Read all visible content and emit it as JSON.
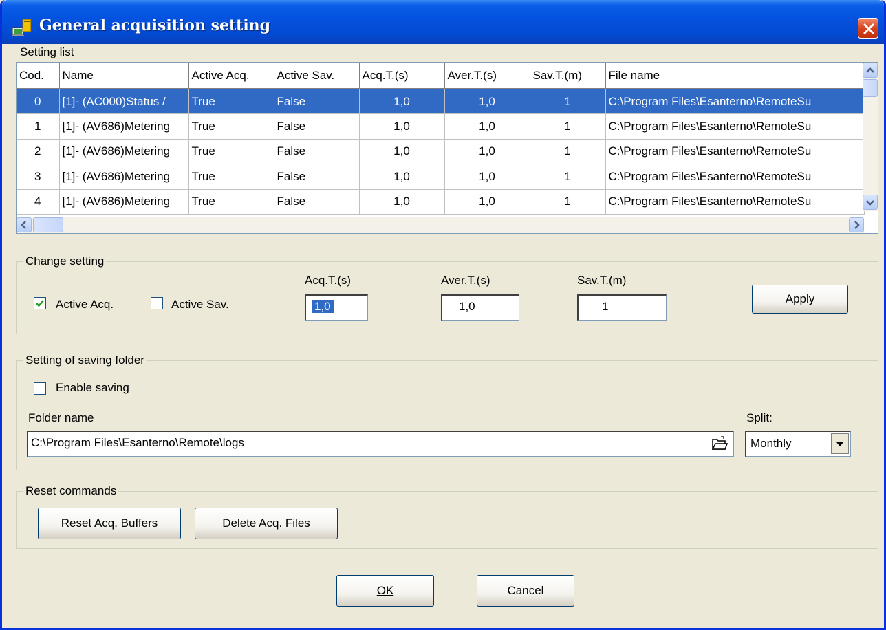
{
  "window": {
    "title": "General acquisition setting"
  },
  "setting_list": {
    "title": "Setting list",
    "columns": [
      "Cod.",
      "Name",
      "Active Acq.",
      "Active Sav.",
      "Acq.T.(s)",
      "Aver.T.(s)",
      "Sav.T.(m)",
      "File name"
    ],
    "rows": [
      [
        "0",
        "[1]- (AC000)Status / ",
        "True",
        "False",
        "1,0",
        "1,0",
        "1",
        "C:\\Program Files\\Esanterno\\RemoteSu"
      ],
      [
        "1",
        "[1]- (AV686)Metering",
        "True",
        "False",
        "1,0",
        "1,0",
        "1",
        "C:\\Program Files\\Esanterno\\RemoteSu"
      ],
      [
        "2",
        "[1]- (AV686)Metering",
        "True",
        "False",
        "1,0",
        "1,0",
        "1",
        "C:\\Program Files\\Esanterno\\RemoteSu"
      ],
      [
        "3",
        "[1]- (AV686)Metering",
        "True",
        "False",
        "1,0",
        "1,0",
        "1",
        "C:\\Program Files\\Esanterno\\RemoteSu"
      ],
      [
        "4",
        "[1]- (AV686)Metering",
        "True",
        "False",
        "1,0",
        "1,0",
        "1",
        "C:\\Program Files\\Esanterno\\RemoteSu"
      ]
    ],
    "selected_row": 0
  },
  "change_setting": {
    "title": "Change setting",
    "active_acq_label": "Active Acq.",
    "active_acq_checked": true,
    "active_sav_label": "Active Sav.",
    "active_sav_checked": false,
    "acq_label": "Acq.T.(s)",
    "acq_value": "1,0",
    "aver_label": "Aver.T.(s)",
    "aver_value": "1,0",
    "sav_label": "Sav.T.(m)",
    "sav_value": "1",
    "apply_label": "Apply"
  },
  "saving_folder": {
    "title": "Setting of saving folder",
    "enable_label": "Enable saving",
    "enable_checked": false,
    "folder_label": "Folder name",
    "folder_value": "C:\\Program Files\\Esanterno\\Remote\\logs",
    "split_label": "Split:",
    "split_value": "Monthly"
  },
  "reset": {
    "title": "Reset commands",
    "reset_buffers_label": "Reset Acq. Buffers",
    "delete_files_label": "Delete Acq. Files"
  },
  "footer": {
    "ok_label": "OK",
    "cancel_label": "Cancel"
  },
  "icons": {
    "title": "computer-icon",
    "close": "close-icon",
    "browse": "folder-open-icon",
    "dropdown": "chevron-down-icon"
  },
  "colors": {
    "title_bar": "#0453e0",
    "selection": "#316ac5",
    "window_bg": "#ece9d8"
  }
}
